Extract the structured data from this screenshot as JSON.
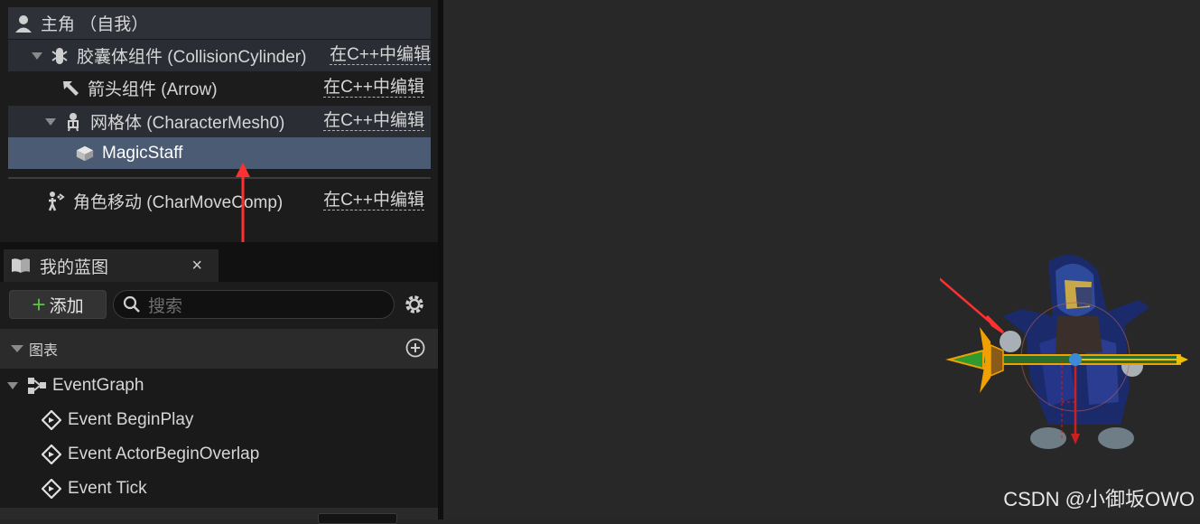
{
  "components": {
    "root_label": "主角 （自我）",
    "capsule_label": "胶囊体组件 (CollisionCylinder)",
    "capsule_edit": "在C++中编辑",
    "arrow_label": "箭头组件 (Arrow)",
    "arrow_edit": "在C++中编辑",
    "mesh_label": "网格体 (CharacterMesh0)",
    "mesh_edit": "在C++中编辑",
    "staff_label": "MagicStaff",
    "move_label": "角色移动 (CharMoveComp)",
    "move_edit": "在C++中编辑"
  },
  "blueprint": {
    "tab_title": "我的蓝图",
    "tab_close": "×",
    "add_label": "添加",
    "search_placeholder": "搜索",
    "section_graphs": "图表",
    "event_graph": "EventGraph",
    "events": [
      "Event BeginPlay",
      "Event ActorBeginOverlap",
      "Event Tick"
    ]
  },
  "viewport": {
    "watermark": "CSDN @小御坂OWO"
  },
  "colors": {
    "selected_row": "#4b5b73",
    "annotation_arrow": "#ff3030",
    "add_plus": "#58c043",
    "staff_outline": "#f0a000"
  },
  "icons": [
    "user-icon",
    "capsule-icon",
    "arrow-icon",
    "skeletal-mesh-icon",
    "static-mesh-icon",
    "movement-icon",
    "book-icon",
    "search-icon",
    "gear-icon",
    "add-circle-icon",
    "graph-icon",
    "event-icon"
  ]
}
